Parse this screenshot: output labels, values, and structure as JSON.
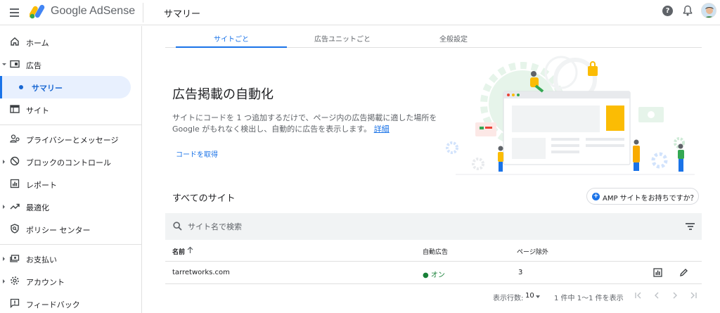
{
  "app": {
    "brand": "Google AdSense",
    "page_title": "サマリー"
  },
  "sidebar": {
    "items": [
      {
        "label": "ホーム"
      },
      {
        "label": "広告"
      },
      {
        "label": "サマリー"
      },
      {
        "label": "サイト"
      },
      {
        "label": "プライバシーとメッセージ"
      },
      {
        "label": "ブロックのコントロール"
      },
      {
        "label": "レポート"
      },
      {
        "label": "最適化"
      },
      {
        "label": "ポリシー センター"
      },
      {
        "label": "お支払い"
      },
      {
        "label": "アカウント"
      },
      {
        "label": "フィードバック"
      }
    ]
  },
  "tabs": [
    {
      "label": "サイトごと"
    },
    {
      "label": "広告ユニットごと"
    },
    {
      "label": "全般設定"
    }
  ],
  "hero": {
    "title": "広告掲載の自動化",
    "desc_line1": "サイトにコードを 1 つ追加するだけで、ページ内の広告掲載に適した場所を",
    "desc_line2": "Google がもれなく検出し、自動的に広告を表示します。",
    "details_link": "詳細",
    "get_code": "コードを取得"
  },
  "sites": {
    "title": "すべてのサイト",
    "amp_button": "AMP サイトをお持ちですか？",
    "search_placeholder": "サイト名で検索",
    "columns": {
      "name": "名前",
      "auto_ads": "自動広告",
      "excluded_pages": "ページ除外"
    },
    "rows": [
      {
        "name": "tarretworks.com",
        "auto_ads": "● オン",
        "excluded_pages": "3"
      }
    ]
  },
  "pagination": {
    "rows_label": "表示行数:",
    "rows_value": "10",
    "range": "1 件中 1〜1 件を表示"
  },
  "colors": {
    "accent": "#1a73e8",
    "active_bg": "#e8f0fe",
    "status_on": "#188038",
    "search_bg": "#f1f3f4"
  }
}
